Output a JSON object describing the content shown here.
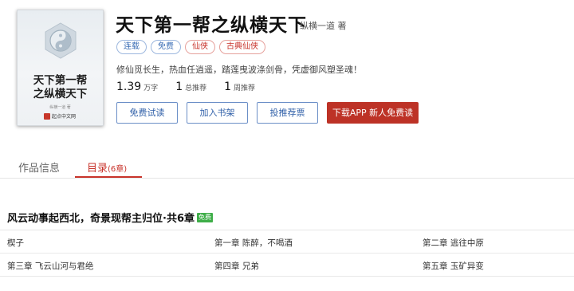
{
  "book": {
    "cover_title": "天下第一帮\n之纵横天下",
    "cover_author": "纵横一道 著",
    "cover_brand": "起点中文网",
    "title": "天下第一帮之纵横天下",
    "author": "纵横一道 著",
    "tags": [
      {
        "label": "连载",
        "style": "blue"
      },
      {
        "label": "免费",
        "style": "blue"
      },
      {
        "label": "仙侠",
        "style": "red"
      },
      {
        "label": "古典仙侠",
        "style": "red"
      }
    ],
    "intro": "修仙觅长生，热血任逍遥，踏莲曳波涤剑骨，凭虚御风塑圣魂！",
    "stats": [
      {
        "value": "1.39",
        "unit": "万字"
      },
      {
        "value": "1",
        "unit": "总推荐"
      },
      {
        "value": "1",
        "unit": "周推荐"
      }
    ]
  },
  "actions": {
    "read": "免费试读",
    "shelf": "加入书架",
    "vote": "投推荐票",
    "download": "下载APP  新人免费读"
  },
  "tabs": {
    "info": "作品信息",
    "catalog": "目录",
    "catalog_count": "(6章)"
  },
  "volume": {
    "title": "风云动事起西北，奇景现帮主归位·共6章",
    "badge": "免费",
    "chapters": [
      "楔子",
      "第一章  陈醉，不喝酒",
      "第二章  逃往中原",
      "第三章  飞云山河与君绝",
      "第四章  兄弟",
      "第五章  玉矿异变"
    ]
  },
  "colors": {
    "accent_red": "#c8332b",
    "link_blue": "#2f5fa8",
    "free_green": "#3fae49"
  }
}
